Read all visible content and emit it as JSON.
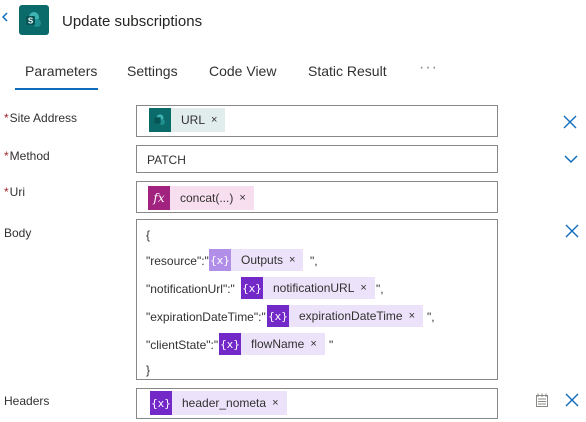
{
  "header": {
    "title": "Update subscriptions",
    "app_icon": "sharepoint-icon",
    "accent": "#0b6a6a"
  },
  "tabs": [
    {
      "label": "Parameters",
      "active": true
    },
    {
      "label": "Settings"
    },
    {
      "label": "Code View"
    },
    {
      "label": "Static Result"
    }
  ],
  "more_label": "···",
  "fields": {
    "site_address": {
      "label": "Site Address",
      "required": true,
      "chip": "URL"
    },
    "method": {
      "label": "Method",
      "required": true,
      "value": "PATCH"
    },
    "uri": {
      "label": "Uri",
      "required": true,
      "chip": "concat(...)",
      "chip_icon_text": "fx"
    },
    "body": {
      "label": "Body",
      "open": "{",
      "close": "}",
      "lines": [
        {
          "prefix": "\"resource\":\"",
          "chip": "Outputs",
          "suffix": "\","
        },
        {
          "prefix": "\"notificationUrl\":\"",
          "chip": "notificationURL",
          "suffix": "\","
        },
        {
          "prefix": "\"expirationDateTime\":\"",
          "chip": "expirationDateTime",
          "suffix": "\","
        },
        {
          "prefix": "\"clientState\":\"",
          "chip": "flowName",
          "suffix": "\""
        }
      ]
    },
    "headers": {
      "label": "Headers",
      "chip": "header_nometa"
    }
  },
  "required_mark": "*",
  "chip_remove": "×",
  "var_icon_text": "{x}",
  "colors": {
    "tab_underline": "#0f6cbd",
    "required": "#a4262c",
    "expression": "#a1227f",
    "variable": "#7328c8"
  }
}
